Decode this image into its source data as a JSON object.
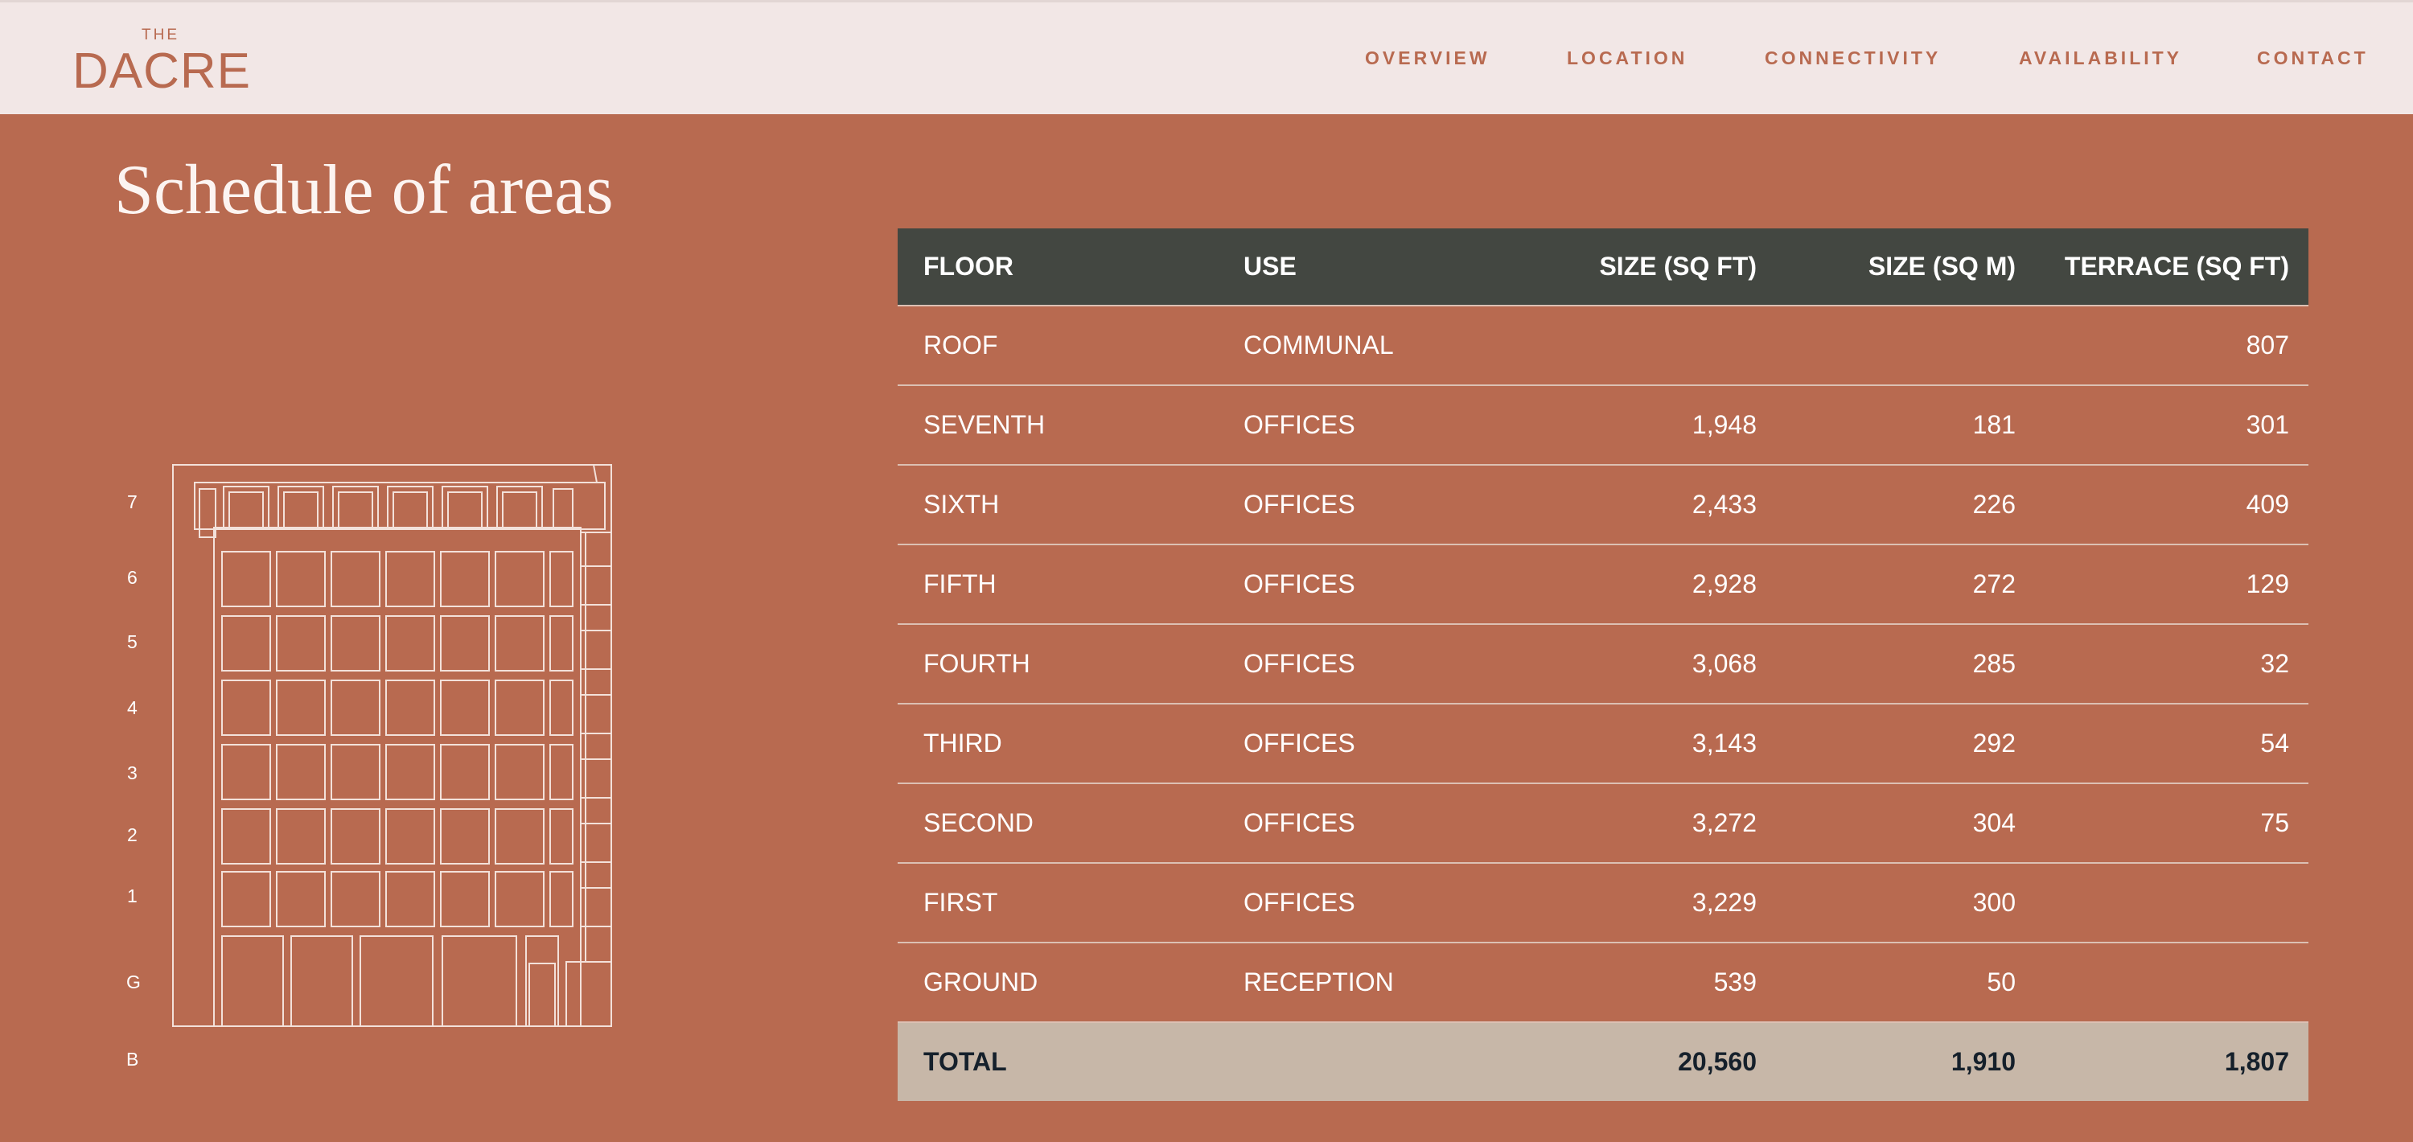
{
  "header": {
    "logo_the": "THE",
    "logo_name": "DACRE",
    "nav": [
      "OVERVIEW",
      "LOCATION",
      "CONNECTIVITY",
      "AVAILABILITY",
      "CONTACT"
    ]
  },
  "page": {
    "title": "Schedule of areas"
  },
  "building": {
    "floor_labels": [
      "7",
      "6",
      "5",
      "4",
      "3",
      "2",
      "1",
      "G",
      "B"
    ]
  },
  "table": {
    "columns": [
      "FLOOR",
      "USE",
      "SIZE (SQ FT)",
      "SIZE (SQ M)",
      "TERRACE (SQ FT)"
    ],
    "rows": [
      {
        "floor": "ROOF",
        "use": "COMMUNAL",
        "sqft": "",
        "sqm": "",
        "terrace": "807"
      },
      {
        "floor": "SEVENTH",
        "use": "OFFICES",
        "sqft": "1,948",
        "sqm": "181",
        "terrace": "301"
      },
      {
        "floor": "SIXTH",
        "use": "OFFICES",
        "sqft": "2,433",
        "sqm": "226",
        "terrace": "409"
      },
      {
        "floor": "FIFTH",
        "use": "OFFICES",
        "sqft": "2,928",
        "sqm": "272",
        "terrace": "129"
      },
      {
        "floor": "FOURTH",
        "use": "OFFICES",
        "sqft": "3,068",
        "sqm": "285",
        "terrace": "32"
      },
      {
        "floor": "THIRD",
        "use": "OFFICES",
        "sqft": "3,143",
        "sqm": "292",
        "terrace": "54"
      },
      {
        "floor": "SECOND",
        "use": "OFFICES",
        "sqft": "3,272",
        "sqm": "304",
        "terrace": "75"
      },
      {
        "floor": "FIRST",
        "use": "OFFICES",
        "sqft": "3,229",
        "sqm": "300",
        "terrace": ""
      },
      {
        "floor": "GROUND",
        "use": "RECEPTION",
        "sqft": "539",
        "sqm": "50",
        "terrace": ""
      }
    ],
    "total": {
      "label": "TOTAL",
      "use": "",
      "sqft": "20,560",
      "sqm": "1,910",
      "terrace": "1,807"
    }
  },
  "colors": {
    "background": "#b86a50",
    "header_bg": "#f2e7e6",
    "table_head": "#434741",
    "total_row": "#c7b7a8"
  }
}
